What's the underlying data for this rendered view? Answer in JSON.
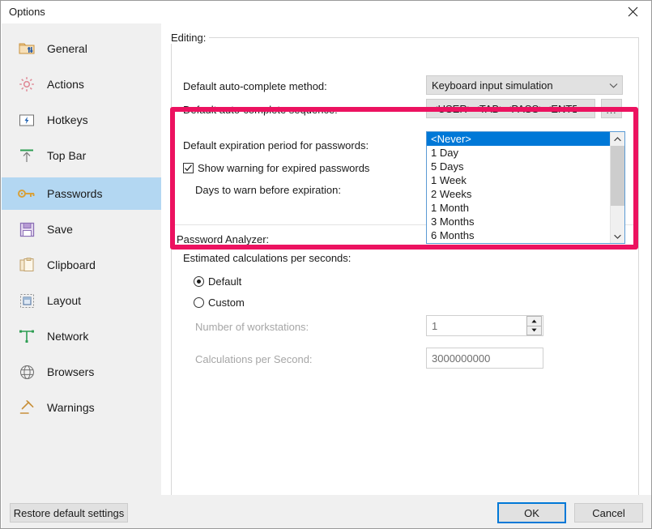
{
  "window": {
    "title": "Options",
    "close_icon": "close-icon"
  },
  "sidebar": {
    "items": [
      {
        "label": "General",
        "icon": "folder-settings-icon",
        "selected": false
      },
      {
        "label": "Actions",
        "icon": "gear-icon",
        "selected": false
      },
      {
        "label": "Hotkeys",
        "icon": "keyboard-key-icon",
        "selected": false
      },
      {
        "label": "Top Bar",
        "icon": "arrow-up-bar-icon",
        "selected": false
      },
      {
        "label": "Passwords",
        "icon": "key-icon",
        "selected": true
      },
      {
        "label": "Save",
        "icon": "floppy-disk-icon",
        "selected": false
      },
      {
        "label": "Clipboard",
        "icon": "clipboard-icon",
        "selected": false
      },
      {
        "label": "Layout",
        "icon": "layout-icon",
        "selected": false
      },
      {
        "label": "Network",
        "icon": "network-icon",
        "selected": false
      },
      {
        "label": "Browsers",
        "icon": "globe-icon",
        "selected": false
      },
      {
        "label": "Warnings",
        "icon": "gavel-icon",
        "selected": false
      }
    ]
  },
  "main": {
    "group_title": "Editing:",
    "auto_complete_method": {
      "label": "Default auto-complete method:",
      "value": "Keyboard input simulation"
    },
    "auto_complete_sequence": {
      "label": "Default auto-complete sequence:",
      "value": "<USER><TAB><PASS><ENTER",
      "browse_label": "..."
    },
    "expiration": {
      "label": "Default expiration period for passwords:",
      "value": "<Never>",
      "options": [
        "<Never>",
        "1 Day",
        "5 Days",
        "1 Week",
        "2 Weeks",
        "1 Month",
        "3 Months",
        "6 Months"
      ],
      "selected_option": "<Never>"
    },
    "show_warning": {
      "label": "Show warning for expired passwords",
      "checked": true
    },
    "days_to_warn_label": "Days to warn before expiration:",
    "password_analyzer": {
      "group_title": "Password Analyzer:",
      "estimated_label": "Estimated calculations per seconds:",
      "mode_default": "Default",
      "mode_custom": "Custom",
      "selected_mode": "Default",
      "workstations_label": "Number of workstations:",
      "workstations_value": "1",
      "calculations_label": "Calculations per Second:",
      "calculations_value": "3000000000"
    }
  },
  "footer": {
    "restore_label": "Restore default settings",
    "ok_label": "OK",
    "cancel_label": "Cancel"
  },
  "annotation": {
    "color": "#ec1260"
  }
}
